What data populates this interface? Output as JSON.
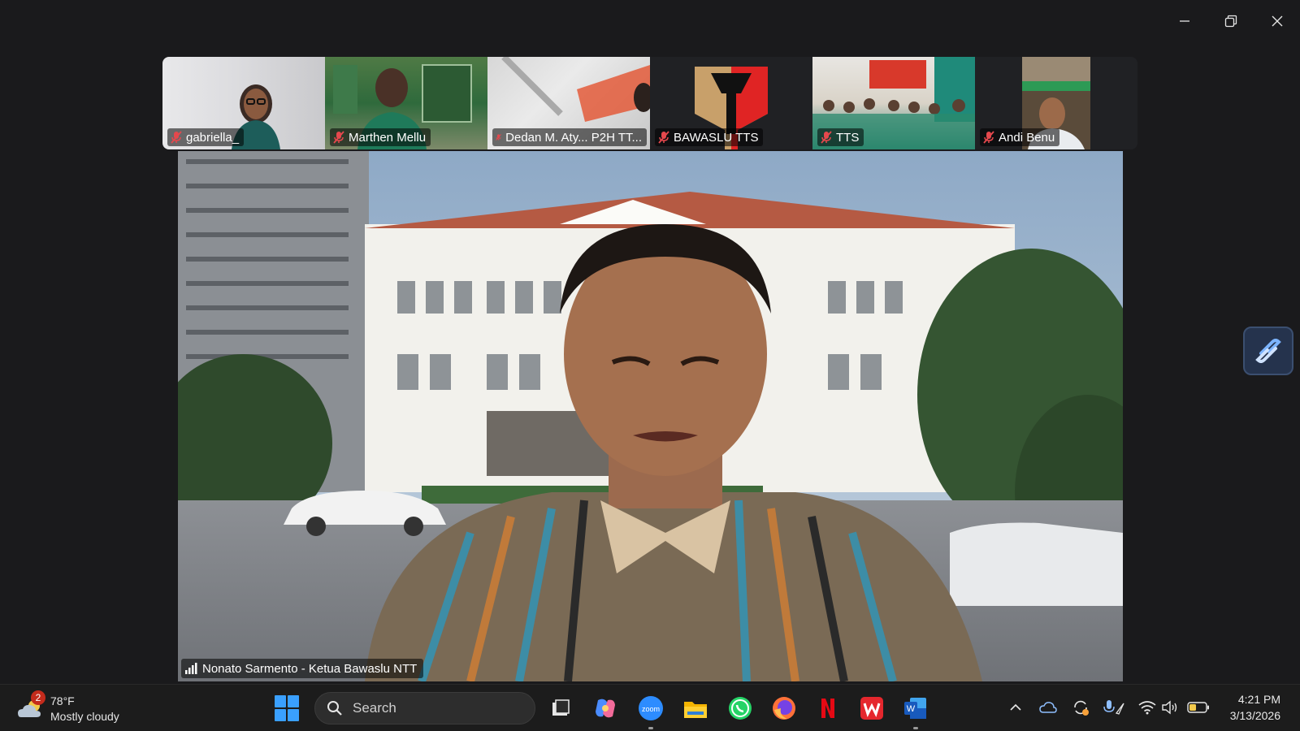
{
  "window": {
    "controls": [
      "minimize-icon",
      "restore-icon",
      "close-icon"
    ]
  },
  "participants": [
    {
      "name": "gabriella_",
      "muted": true
    },
    {
      "name": "Marthen Mellu",
      "muted": true
    },
    {
      "name": "Dedan M. Aty... P2H TT...",
      "muted": true
    },
    {
      "name": "BAWASLU TTS",
      "muted": true
    },
    {
      "name": "TTS",
      "muted": true
    },
    {
      "name": "Andi Benu",
      "muted": true
    }
  ],
  "active_speaker": {
    "name": "Nonato Sarmento - Ketua Bawaslu NTT"
  },
  "taskbar": {
    "weather": {
      "badge": "2",
      "temp": "78°F",
      "condition": "Mostly cloudy"
    },
    "search_label": "Search",
    "apps": [
      "file-explorer-dark-icon",
      "copilot-icon",
      "zoom-icon",
      "folder-icon",
      "whatsapp-icon",
      "firefox-icon",
      "netflix-icon",
      "wps-icon",
      "word-icon"
    ],
    "clock": {
      "time": "4:21 PM",
      "date": "3/13/2026"
    }
  },
  "colors": {
    "accent": "#3aa0ff",
    "muted_red": "#e5484d",
    "zoom_blue": "#2d8cff"
  }
}
